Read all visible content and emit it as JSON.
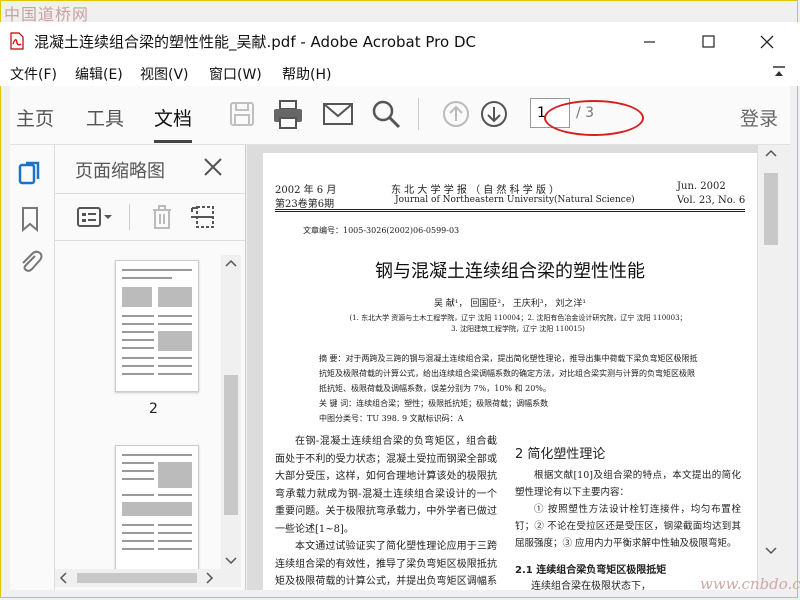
{
  "watermark_top": "中国道桥网",
  "watermark_bottom": "www.cnbdo.com",
  "window": {
    "title": "混凝土连续组合梁的塑性性能_吴献.pdf - Adobe Acrobat Pro DC"
  },
  "menu": [
    "文件(F)",
    "编辑(E)",
    "视图(V)",
    "窗口(W)",
    "帮助(H)"
  ],
  "toolbar": {
    "tabs": [
      "主页",
      "工具",
      "文档"
    ],
    "active_tab": "文档",
    "current_page": "1",
    "total_pages": "/ 3",
    "login": "登录",
    "icons": [
      "save-icon",
      "print-icon",
      "email-icon",
      "search-icon",
      "page-up-icon",
      "page-down-icon"
    ]
  },
  "thumbnail_panel": {
    "title": "页面缩略图",
    "page_label": "2"
  },
  "colors": {
    "highlight_ellipse": "#d62020",
    "frame": "#e2c400",
    "accent": "#1a73c8"
  },
  "document": {
    "header_left_1": "2002 年 6 月",
    "header_left_2": "第23卷第6期",
    "header_center_1": "东 北 大 学 学 报 （ 自 然 科 学 版 ）",
    "header_center_2": "Journal of Northeastern University(Natural Science)",
    "header_right_1": "Jun.  2002",
    "header_right_2": "Vol. 23, No. 6",
    "article_no": "文章编号：1005-3026(2002)06-0599-03",
    "title": "钢与混凝土连续组合梁的塑性性能",
    "authors": "吴    献¹，  回国臣²，  王庆利³，  刘之洋¹",
    "affil_1": "(1. 东北大学 资源与土木工程学院，辽宁 沈阳   110004；2. 沈阳有色冶金设计研究院，辽宁 沈阳   110003；",
    "affil_2": "3. 沈阳建筑工程学院，辽宁 沈阳   110015)",
    "abstract": "摘      要：对于两跨及三跨的钢与混凝土连续组合梁，提出简化塑性理论，推导出集中荷载下梁负弯矩区极限抵抗矩及极限荷载的计算公式，给出连续组合梁调幅系数的确定方法，对比组合梁实测与计算的负弯矩区极限抵抗矩、极限荷载及调幅系数，误差分别为 7%，10% 和 20%。",
    "keywords": "关   键   词：连续组合梁；塑性；极限抵抗矩；极限荷载；调幅系数",
    "classification": "中图分类号：TU  398. 9          文献标识码：A",
    "body_left": "在钢-混凝土连续组合梁的负弯矩区，组合截面处于不利的受力状态；混凝土受拉而钢梁全部或大部分受压，这样，如何合理地计算该处的极限抗弯承载力就成为钢-混凝土连续组合梁设计的一个重要问题。关于极限抗弯承载力，中外学者已做过一些论述[1~8]。",
    "body_left_2": "本文通过试验证实了简化塑性理论应用于三跨连续组合梁的有效性，推导了梁负弯矩区极限抵抗矩及极限荷载的计算公式，并提出负弯矩区调幅系数的确定方法。",
    "section_2": "2   简化塑性理论",
    "body_right": "根据文献[10]及组合梁的特点，本文提出的简化塑性理论有以下主要内容：",
    "body_right_2": "① 按照塑性方法设计栓钉连接件，均匀布置栓钉；② 不论在受拉区还是受压区，钢梁截面均达到其屈服强度；③ 应用内力平衡求解中性轴及极限弯矩。",
    "section_2_1": "2.1   连续组合梁负弯矩区极限抵矩",
    "body_right_3": "连续组合梁在极限状态下，"
  }
}
